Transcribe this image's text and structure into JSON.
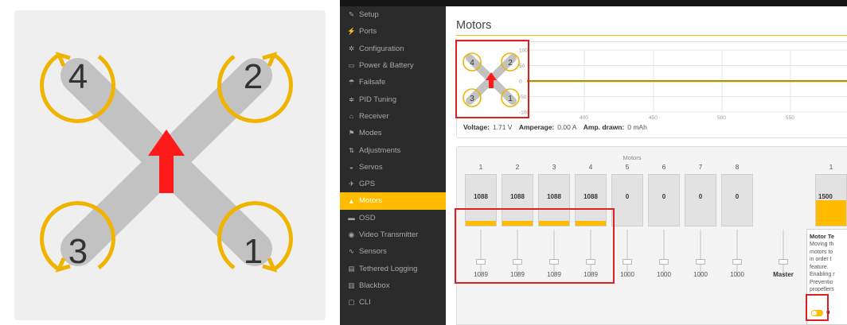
{
  "sidebar": {
    "items": [
      {
        "label": "Setup",
        "icon": "wrench-icon",
        "glyph": "✎",
        "active": false
      },
      {
        "label": "Ports",
        "icon": "plug-icon",
        "glyph": "⚡",
        "active": false
      },
      {
        "label": "Configuration",
        "icon": "gear-icon",
        "glyph": "✲",
        "active": false
      },
      {
        "label": "Power & Battery",
        "icon": "battery-icon",
        "glyph": "▭",
        "active": false
      },
      {
        "label": "Failsafe",
        "icon": "parachute-icon",
        "glyph": "☂",
        "active": false
      },
      {
        "label": "PID Tuning",
        "icon": "sliders-icon",
        "glyph": "≑",
        "active": false
      },
      {
        "label": "Receiver",
        "icon": "receiver-icon",
        "glyph": "⌂",
        "active": false
      },
      {
        "label": "Modes",
        "icon": "modes-icon",
        "glyph": "⚑",
        "active": false
      },
      {
        "label": "Adjustments",
        "icon": "adjustments-icon",
        "glyph": "⇅",
        "active": false
      },
      {
        "label": "Servos",
        "icon": "servo-icon",
        "glyph": "◒",
        "active": false
      },
      {
        "label": "GPS",
        "icon": "satellite-icon",
        "glyph": "✈",
        "active": false
      },
      {
        "label": "Motors",
        "icon": "motor-icon",
        "glyph": "▲",
        "active": true
      },
      {
        "label": "OSD",
        "icon": "osd-icon",
        "glyph": "▬",
        "active": false
      },
      {
        "label": "Video Transmitter",
        "icon": "antenna-icon",
        "glyph": "◉",
        "active": false
      },
      {
        "label": "Sensors",
        "icon": "sensors-icon",
        "glyph": "∿",
        "active": false
      },
      {
        "label": "Tethered Logging",
        "icon": "logging-icon",
        "glyph": "▤",
        "active": false
      },
      {
        "label": "Blackbox",
        "icon": "blackbox-icon",
        "glyph": "▥",
        "active": false
      },
      {
        "label": "CLI",
        "icon": "terminal-icon",
        "glyph": "▢",
        "active": false
      }
    ]
  },
  "main": {
    "title": "Motors",
    "graph": {
      "y_ticks": [
        "100",
        "50",
        "0",
        "-50",
        "-100"
      ],
      "x_ticks": [
        "400",
        "450",
        "500",
        "550"
      ]
    },
    "status": {
      "voltage_label": "Voltage:",
      "voltage_value": "1.71 V",
      "amperage_label": "Amperage:",
      "amperage_value": "0.00 A",
      "drawn_label": "Amp. drawn:",
      "drawn_value": "0 mAh"
    },
    "motors_label": "Motors",
    "motors": [
      {
        "num": "1",
        "value": "1088",
        "slider": "1089",
        "fill": 0.09
      },
      {
        "num": "2",
        "value": "1088",
        "slider": "1089",
        "fill": 0.09
      },
      {
        "num": "3",
        "value": "1088",
        "slider": "1089",
        "fill": 0.09
      },
      {
        "num": "4",
        "value": "1088",
        "slider": "1089",
        "fill": 0.09
      },
      {
        "num": "5",
        "value": "0",
        "slider": "1000",
        "fill": 0
      },
      {
        "num": "6",
        "value": "0",
        "slider": "1000",
        "fill": 0
      },
      {
        "num": "7",
        "value": "0",
        "slider": "1000",
        "fill": 0
      },
      {
        "num": "8",
        "value": "0",
        "slider": "1000",
        "fill": 0
      }
    ],
    "master_label": "Master",
    "servo": {
      "num": "1",
      "value": "1500",
      "fill": 0.5
    },
    "tip": {
      "title": "Motor Te",
      "lines": [
        "Moving th",
        "motors to",
        "in order t",
        "feature.",
        "Enabling r",
        "Preventio",
        "propellers"
      ],
      "toggle_label": "u"
    }
  },
  "diagram": {
    "motor_labels": [
      "4",
      "2",
      "3",
      "1"
    ]
  },
  "colors": {
    "accent": "#ffbb00",
    "highlight": "#e02020",
    "sidebar_bg": "#2b2b2b",
    "arrow": "#ff1a1a"
  }
}
